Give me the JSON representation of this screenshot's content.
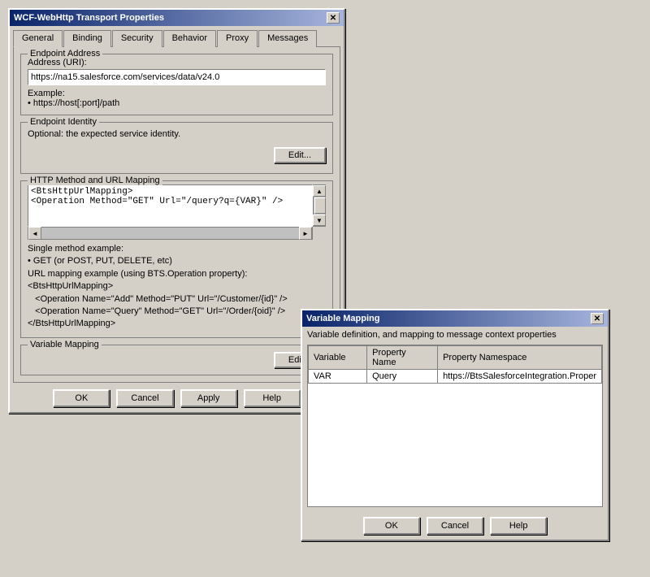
{
  "mainDialog": {
    "title": "WCF-WebHttp Transport Properties",
    "tabs": [
      {
        "label": "General",
        "active": true
      },
      {
        "label": "Binding",
        "active": false
      },
      {
        "label": "Security",
        "active": false
      },
      {
        "label": "Behavior",
        "active": false
      },
      {
        "label": "Proxy",
        "active": false
      },
      {
        "label": "Messages",
        "active": false
      }
    ],
    "endpointAddress": {
      "groupLabel": "Endpoint Address",
      "addressLabel": "Address (URI):",
      "addressValue": "https://na15.salesforce.com/services/data/v24.0",
      "exampleLabel": "Example:",
      "exampleValue": "• https://host[:port]/path"
    },
    "endpointIdentity": {
      "groupLabel": "Endpoint Identity",
      "description": "Optional: the expected service identity.",
      "editButton": "Edit..."
    },
    "httpMethod": {
      "groupLabel": "HTTP Method and URL Mapping",
      "xmlContent": "<BtsHttpUrlMapping>\n<Operation Method=\"GET\" Url=\"/query?q={VAR}\" />",
      "infoText": "Single method example:\n• GET (or POST, PUT, DELETE, etc)\nURL mapping example (using BTS.Operation property):\n<BtsHttpUrlMapping>\n   <Operation Name=\"Add\" Method=\"PUT\" Url=\"/Customer/{id}\" />\n   <Operation Name=\"Query\" Method=\"GET\" Url=\"/Order/{oid}\" />\n</BtsHttpUrlMapping>"
    },
    "variableMapping": {
      "groupLabel": "Variable Mapping",
      "editButton": "Edit..."
    },
    "buttons": {
      "ok": "OK",
      "cancel": "Cancel",
      "apply": "Apply",
      "help": "Help"
    }
  },
  "varDialog": {
    "title": "Variable Mapping",
    "description": "Variable definition, and mapping to message context properties",
    "columns": [
      "Variable",
      "Property Name",
      "Property Namespace"
    ],
    "rows": [
      {
        "variable": "VAR",
        "propertyName": "Query",
        "propertyNamespace": "https://BtsSalesforceIntegration.Proper"
      }
    ],
    "buttons": {
      "ok": "OK",
      "cancel": "Cancel",
      "help": "Help"
    }
  }
}
